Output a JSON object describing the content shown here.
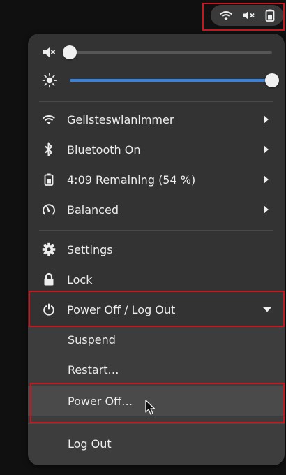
{
  "topbar": {
    "icons": [
      "wifi-icon",
      "volume-muted-icon",
      "battery-icon"
    ]
  },
  "colors": {
    "panel_bg": "#333333",
    "submenu_bg": "#3d3d3d",
    "accent": "#3584e4",
    "highlight_box": "#c6181e",
    "text": "#eeeeee"
  },
  "sliders": {
    "volume": {
      "icon": "volume-muted-icon",
      "level": 0.0
    },
    "brightness": {
      "icon": "brightness-icon",
      "level": 1.0
    }
  },
  "menu": {
    "wifi": {
      "icon": "wifi-icon",
      "label": "Geilsteswlanimmer"
    },
    "bluetooth": {
      "icon": "bluetooth-icon",
      "label": "Bluetooth On"
    },
    "battery": {
      "icon": "battery-icon",
      "label": "4:09 Remaining (54 %)"
    },
    "power_mode": {
      "icon": "power-mode-icon",
      "label": "Balanced"
    },
    "settings": {
      "icon": "gear-icon",
      "label": "Settings"
    },
    "lock": {
      "icon": "lock-icon",
      "label": "Lock"
    },
    "power": {
      "icon": "power-icon",
      "label": "Power Off / Log Out"
    }
  },
  "power_submenu": {
    "suspend": "Suspend",
    "restart": "Restart…",
    "power_off": "Power Off…",
    "log_out": "Log Out"
  }
}
